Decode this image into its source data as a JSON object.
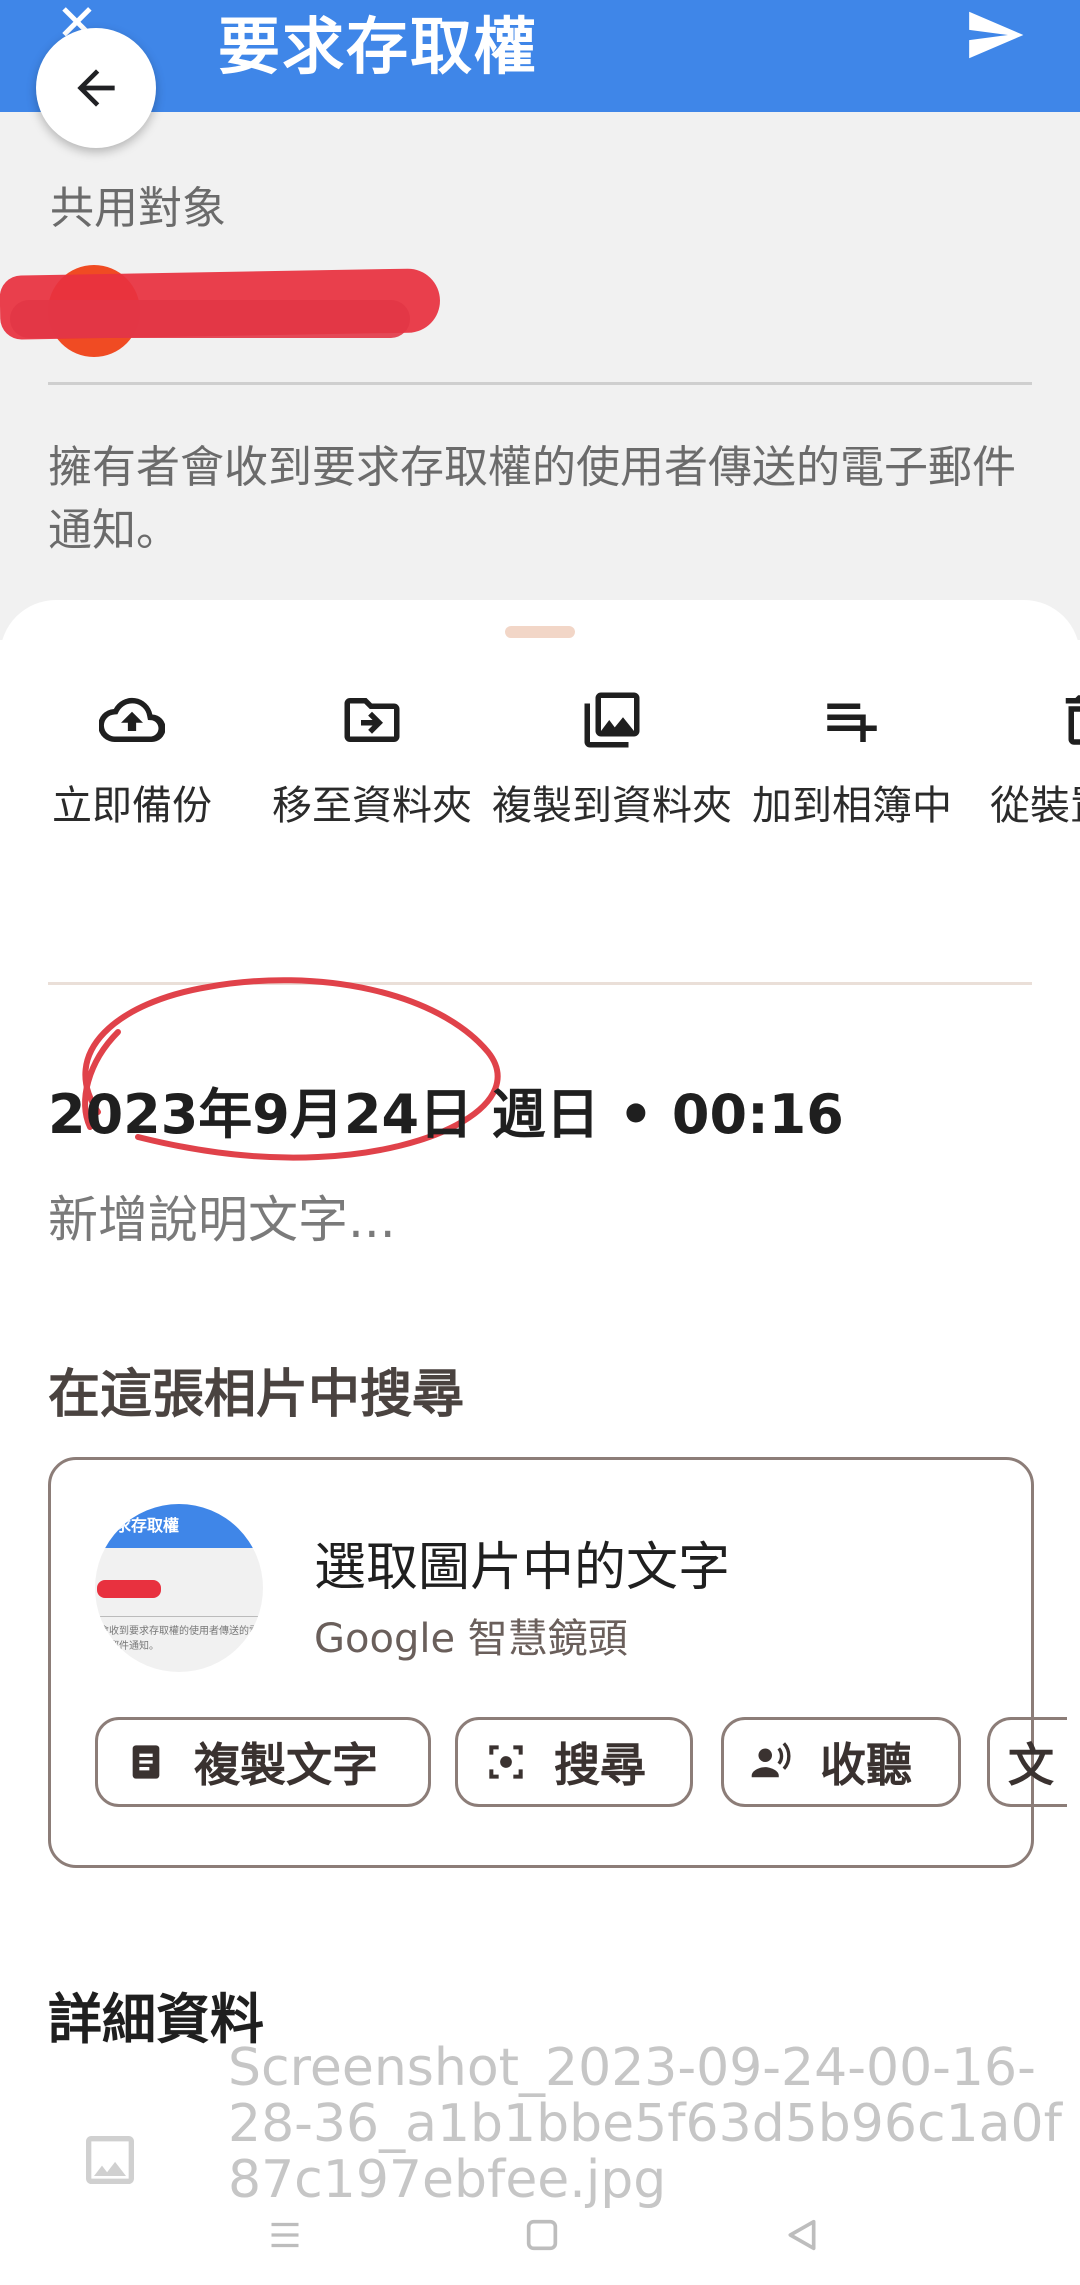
{
  "photo": {
    "title": "要求存取權",
    "close_icon": "close-icon",
    "send_icon": "send-icon",
    "share_label": "共用對象",
    "description": "擁有者會收到要求存取權的使用者傳送的電子郵件通知。"
  },
  "actions": [
    {
      "label": "立即備份",
      "icon": "cloud-upload-icon"
    },
    {
      "label": "移至資料夾",
      "icon": "move-to-folder-icon"
    },
    {
      "label": "複製到資料夾",
      "icon": "copy-to-folder-icon"
    },
    {
      "label": "加到相簿中",
      "icon": "playlist-add-icon"
    },
    {
      "label": "從裝置中刪除",
      "icon": "delete-from-device-icon"
    }
  ],
  "info": {
    "date": "2023年9月24日 週日 • 00:16",
    "caption_placeholder": "新增說明文字..."
  },
  "lens": {
    "heading": "在這張相片中搜尋",
    "title": "選取圖片中的文字",
    "subtitle": "Google 智慧鏡頭",
    "thumb_title": "要求存取權",
    "thumb_text": "會收到要求存取權的使用者傳送的電子郵件通知。",
    "chips": [
      {
        "label": "複製文字",
        "icon": "document-icon"
      },
      {
        "label": "搜尋",
        "icon": "lens-search-icon"
      },
      {
        "label": "收聽",
        "icon": "listen-icon"
      },
      {
        "label": "文",
        "icon": "translate-icon"
      }
    ]
  },
  "details": {
    "heading": "詳細資料",
    "filename": "Screenshot_2023-09-24-00-16-28-36_a1b1bbe5f63d5b96c1a0f87c197ebfee.jpg",
    "file_icon": "image-icon"
  },
  "navbar": {
    "menu_icon": "menu-icon",
    "home_icon": "home-icon",
    "back_icon": "back-triangle-icon"
  }
}
